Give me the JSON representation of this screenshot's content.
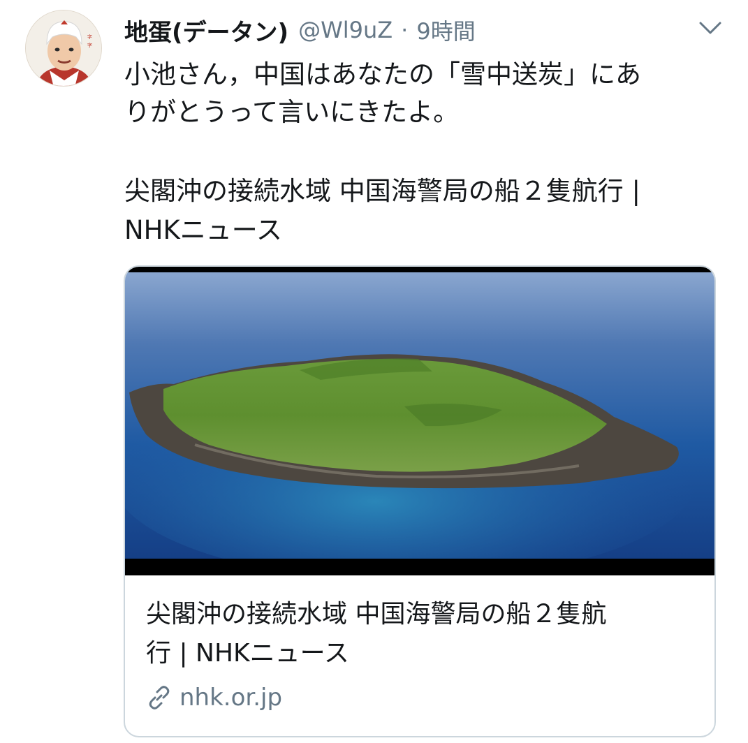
{
  "tweet": {
    "author": {
      "display_name": "地蛋(データン)",
      "handle": "@Wl9uZ",
      "avatar_icon": "user-avatar"
    },
    "separator": "·",
    "timestamp": "9時間",
    "menu_icon": "chevron-down-icon",
    "text_lines": [
      "小池さん，中国はあなたの「雪中送炭」にあ",
      "りがとうって言いにきたよ。"
    ],
    "link_text_lines": [
      "尖閣沖の接続水域 中国海警局の船２隻航行 |",
      "NHKニュース"
    ],
    "card": {
      "image_icon": "island-aerial-photo",
      "title_lines": [
        "尖閣沖の接続水域 中国海警局の船２隻航",
        "行 | NHKニュース"
      ],
      "domain": "nhk.or.jp",
      "domain_icon": "link-icon"
    }
  },
  "colors": {
    "text": "#14171a",
    "secondary": "#657786",
    "border": "#ccd6dd",
    "sea": "#1f5aa3",
    "island": "#5e8f2f"
  }
}
